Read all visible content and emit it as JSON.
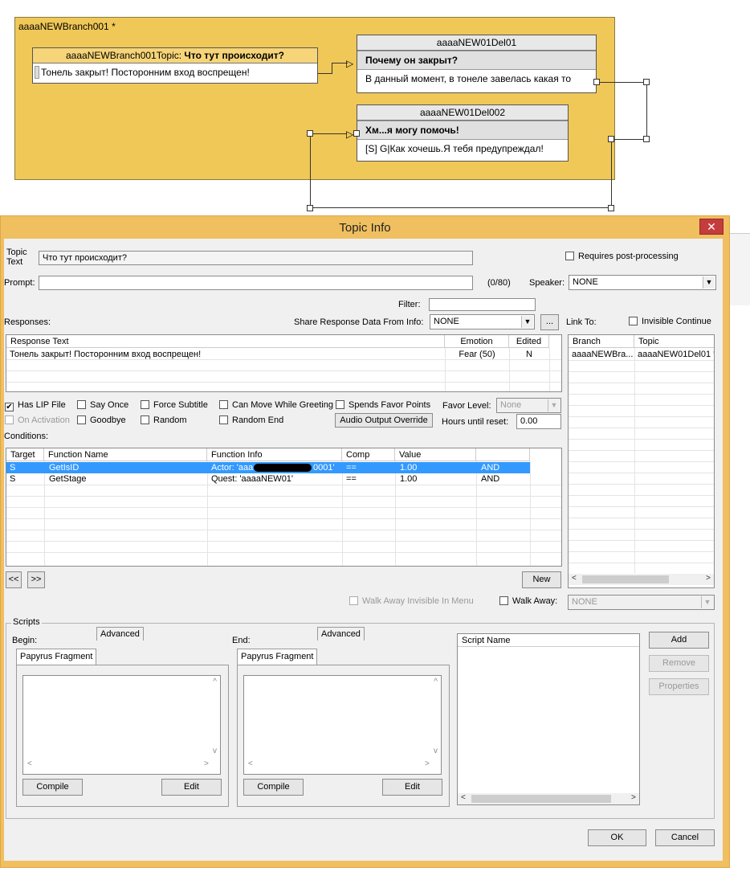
{
  "graph": {
    "branch_title": "aaaaNEWBranch001 *",
    "topic_node": {
      "title_prefix": "aaaaNEWBranch001Topic: ",
      "title_bold": "Что тут происходит?",
      "response": "Тонель закрыт! Посторонним вход воспрещен!"
    },
    "node1": {
      "title": "aaaaNEW01Del01",
      "prompt": "Почему он закрыт?",
      "response": "В данный момент, в тонеле завелась какая то"
    },
    "node2": {
      "title": "aaaaNEW01Del002",
      "prompt": "Хм...я могу помочь!",
      "response": "[S] G|Как хочешь.Я тебя предупреждал!"
    }
  },
  "window": {
    "title": "Topic Info",
    "close_label": "✕"
  },
  "topic": {
    "topic_text_label": "Topic\nText",
    "topic_text_value": "Что тут происходит?",
    "requires_post_label": "Requires post-processing",
    "prompt_label": "Prompt:",
    "prompt_value": "",
    "prompt_count": "(0/80)",
    "speaker_label": "Speaker:",
    "speaker_value": "NONE",
    "filter_label": "Filter:",
    "filter_value": ""
  },
  "responses": {
    "label": "Responses:",
    "share_label": "Share Response Data From Info:",
    "share_value": "NONE",
    "ellipsis_label": "...",
    "headers": [
      "Response Text",
      "Emotion",
      "Edited"
    ],
    "rows": [
      {
        "text": "Тонель закрыт! Посторонним вход воспрещен!",
        "emotion": "Fear (50)",
        "edited": "N"
      }
    ]
  },
  "link_to": {
    "label": "Link To:",
    "invisible_continue_label": "Invisible Continue",
    "headers": [
      "Branch",
      "Topic"
    ],
    "rows": [
      {
        "branch": "aaaaNEWBra...",
        "topic": "aaaaNEW01Del01 *"
      }
    ]
  },
  "options": {
    "has_lip": "Has LIP File",
    "say_once": "Say Once",
    "force_subtitle": "Force Subtitle",
    "can_move": "Can Move While Greeting",
    "spends_favor": "Spends Favor Points",
    "favor_level_label": "Favor Level:",
    "favor_level_value": "None",
    "on_activation": "On Activation",
    "goodbye": "Goodbye",
    "random": "Random",
    "random_end": "Random End",
    "audio_override": "Audio Output Override",
    "hours_label": "Hours until reset:",
    "hours_value": "0.00"
  },
  "conditions": {
    "label": "Conditions:",
    "headers": [
      "Target",
      "Function Name",
      "Function Info",
      "Comp",
      "Value",
      ""
    ],
    "rows": [
      {
        "target": "S",
        "function": "GetIsID",
        "info_a": "Actor: 'aaa",
        "info_b": "0001'",
        "comp": "==",
        "value": "1.00",
        "op": "AND"
      },
      {
        "target": "S",
        "function": "GetStage",
        "info_a": "Quest: 'aaaaNEW01'",
        "info_b": "",
        "comp": "==",
        "value": "1.00",
        "op": "AND"
      }
    ],
    "prev_label": "<<",
    "next_label": ">>",
    "new_label": "New"
  },
  "walk": {
    "walk_away_invisible": "Walk Away Invisible In Menu",
    "walk_away_label": "Walk Away:",
    "walk_away_value": "NONE"
  },
  "scripts": {
    "group_label": "Scripts",
    "begin_label": "Begin:",
    "end_label": "End:",
    "tab_papyrus": "Papyrus Fragment",
    "tab_advanced": "Advanced",
    "compile_label": "Compile",
    "edit_label": "Edit",
    "script_name_header": "Script Name",
    "add_label": "Add",
    "remove_label": "Remove",
    "properties_label": "Properties"
  },
  "footer": {
    "ok_label": "OK",
    "cancel_label": "Cancel"
  }
}
